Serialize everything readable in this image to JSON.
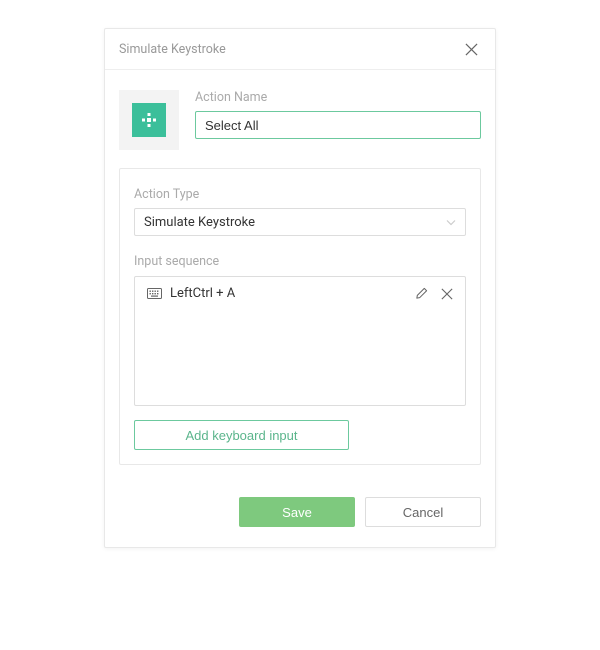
{
  "dialog": {
    "title": "Simulate Keystroke",
    "actionNameLabel": "Action Name",
    "actionNameValue": "Select All",
    "actionTypeLabel": "Action Type",
    "actionTypeValue": "Simulate Keystroke",
    "inputSequenceLabel": "Input sequence",
    "sequence": [
      {
        "text": "LeftCtrl + A"
      }
    ],
    "addButtonLabel": "Add keyboard input",
    "saveLabel": "Save",
    "cancelLabel": "Cancel"
  }
}
